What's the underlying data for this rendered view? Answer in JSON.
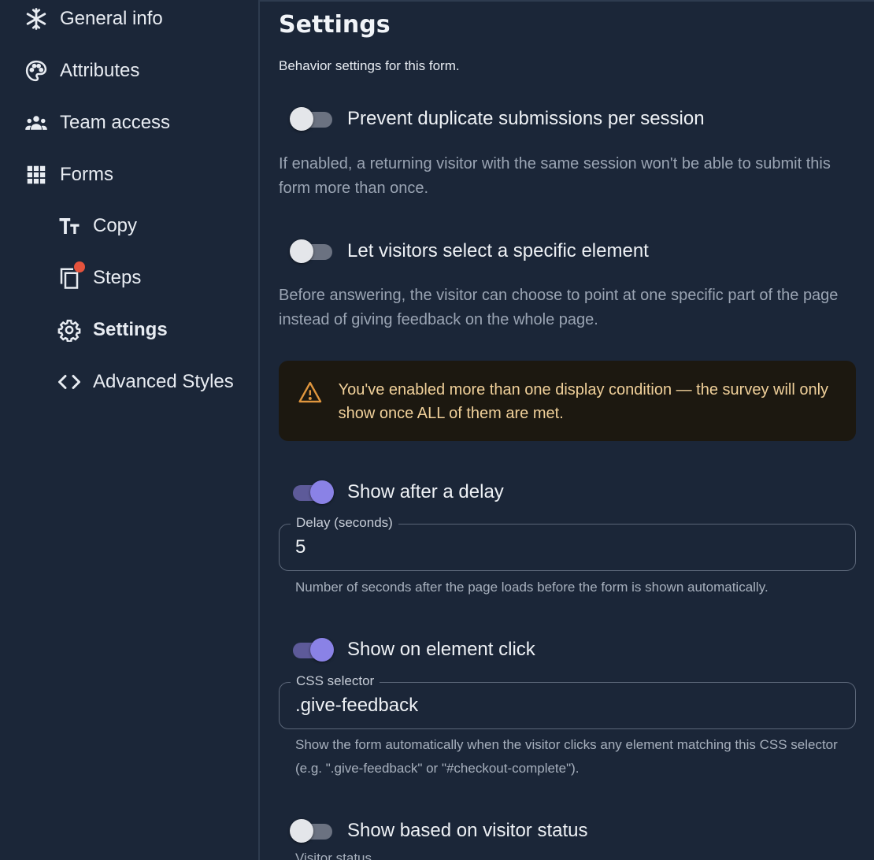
{
  "sidebar": {
    "items": [
      {
        "label": "General info",
        "icon": "snowflake-icon"
      },
      {
        "label": "Attributes",
        "icon": "palette-icon"
      },
      {
        "label": "Team access",
        "icon": "team-icon"
      },
      {
        "label": "Forms",
        "icon": "grid-icon"
      },
      {
        "label": "Copy",
        "icon": "text-size-icon"
      },
      {
        "label": "Steps",
        "icon": "layers-icon"
      },
      {
        "label": "Settings",
        "icon": "gear-icon",
        "active": true
      },
      {
        "label": "Advanced Styles",
        "icon": "code-icon"
      }
    ]
  },
  "main": {
    "title": "Settings",
    "subtitle": "Behavior settings for this form.",
    "prevent_duplicates": {
      "label": "Prevent duplicate submissions per session",
      "enabled": false,
      "help": "If enabled, a returning visitor with the same session won't be able to submit this form more than once."
    },
    "select_element": {
      "label": "Let visitors select a specific element",
      "enabled": false,
      "help": "Before answering, the visitor can choose to point at one specific part of the page instead of giving feedback on the whole page."
    },
    "alert": {
      "text": "You've enabled more than one display condition — the survey will only show once ALL of them are met.",
      "color": "#f0d09a"
    },
    "delay": {
      "label": "Show after a delay",
      "enabled": true,
      "field_label": "Delay (seconds)",
      "value": "5",
      "help": "Number of seconds after the page loads before the form is shown automatically."
    },
    "element_click": {
      "label": "Show on element click",
      "enabled": true,
      "field_label": "CSS selector",
      "value": ".give-feedback",
      "help": "Show the form automatically when the visitor clicks any element matching this CSS selector (e.g. \".give-feedback\" or \"#checkout-complete\")."
    },
    "visitor_status": {
      "label": "Show based on visitor status",
      "enabled": false,
      "field_label_partial": "Visitor status"
    }
  },
  "colors": {
    "background": "#1b2638",
    "accent": "#8a82e6",
    "notification_dot": "#e5533d"
  }
}
